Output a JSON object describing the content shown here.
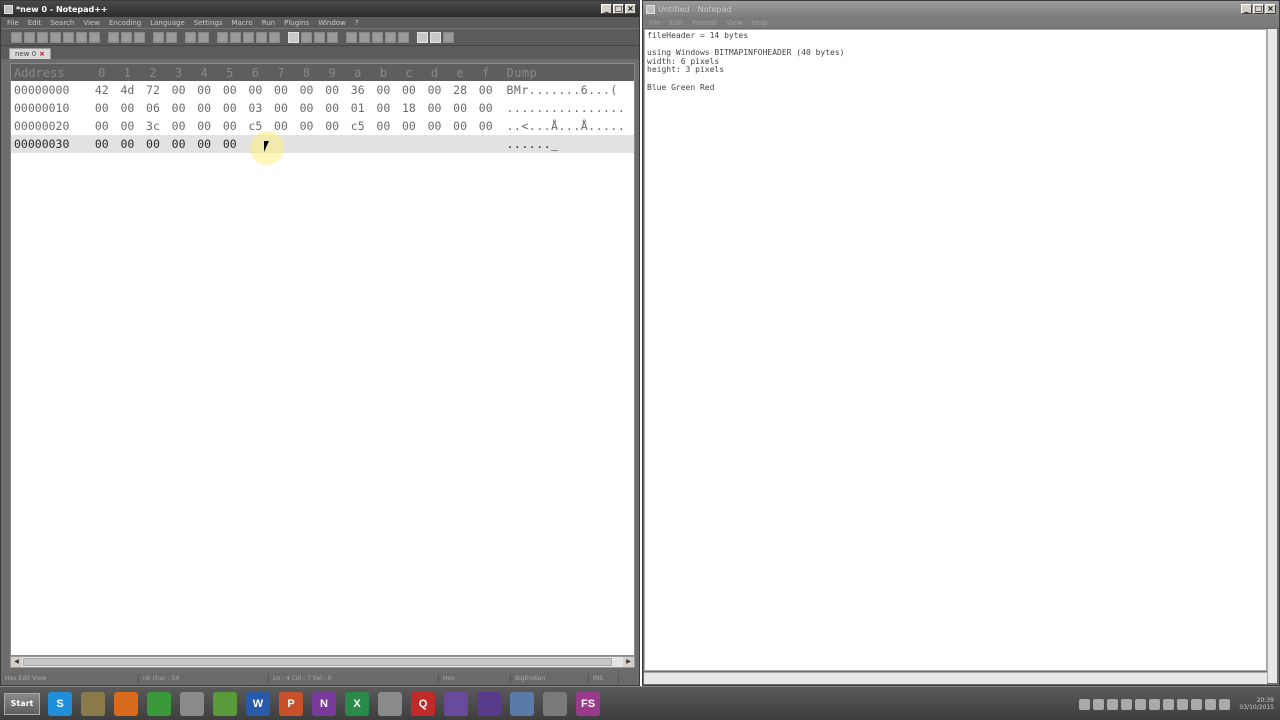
{
  "npp": {
    "title": "*new 0 - Notepad++",
    "menu": [
      "File",
      "Edit",
      "Search",
      "View",
      "Encoding",
      "Language",
      "Settings",
      "Macro",
      "Run",
      "Plugins",
      "Window",
      "?"
    ],
    "tab_label": "new 0",
    "hex_header": {
      "address": "Address",
      "columns": [
        "0",
        "1",
        "2",
        "3",
        "4",
        "5",
        "6",
        "7",
        "8",
        "9",
        "a",
        "b",
        "c",
        "d",
        "e",
        "f"
      ],
      "dump": "Dump"
    },
    "rows": [
      {
        "addr": "00000000",
        "bytes": [
          "42",
          "4d",
          "72",
          "00",
          "00",
          "00",
          "00",
          "00",
          "00",
          "00",
          "36",
          "00",
          "00",
          "00",
          "28",
          "00"
        ],
        "dump": "BMr.......6...("
      },
      {
        "addr": "00000010",
        "bytes": [
          "00",
          "00",
          "06",
          "00",
          "00",
          "00",
          "03",
          "00",
          "00",
          "00",
          "01",
          "00",
          "18",
          "00",
          "00",
          "00"
        ],
        "dump": "................"
      },
      {
        "addr": "00000020",
        "bytes": [
          "00",
          "00",
          "3c",
          "00",
          "00",
          "00",
          "c5",
          "00",
          "00",
          "00",
          "c5",
          "00",
          "00",
          "00",
          "00",
          "00"
        ],
        "dump": "..<...Å...Å....."
      },
      {
        "addr": "00000030",
        "bytes": [
          "00",
          "00",
          "00",
          "00",
          "00",
          "00",
          "",
          "",
          "",
          "",
          "",
          "",
          "",
          "",
          "",
          ""
        ],
        "dump": "......_"
      }
    ],
    "status": [
      "Hex Edit View",
      "nb char : 54",
      "Ln : 4    Col : 7    Sel : 0",
      "Hex",
      "BigEndian",
      "INS"
    ]
  },
  "notepad": {
    "title": "Untitled - Notepad",
    "menu": [
      "File",
      "Edit",
      "Format",
      "View",
      "Help"
    ],
    "text": "fileHeader = 14 bytes\n\nusing Windows BITMAPINFOHEADER (40 bytes)\nwidth: 6 pixels\nheight: 3 pixels\n\nBlue Green Red"
  },
  "taskbar": {
    "start_label": "Start",
    "apps": [
      {
        "name": "skype",
        "glyph": "S",
        "color": "#1e8fd8"
      },
      {
        "name": "folder",
        "glyph": "",
        "color": "#8a7a4a"
      },
      {
        "name": "firefox",
        "glyph": "",
        "color": "#d86a1e"
      },
      {
        "name": "chrome",
        "glyph": "",
        "color": "#3a9a3a"
      },
      {
        "name": "editor",
        "glyph": "",
        "color": "#8a8a8a"
      },
      {
        "name": "notepadpp",
        "glyph": "",
        "color": "#5a9a3a"
      },
      {
        "name": "word",
        "glyph": "W",
        "color": "#2a5aaa"
      },
      {
        "name": "powerpoint",
        "glyph": "P",
        "color": "#c8502a"
      },
      {
        "name": "onenote",
        "glyph": "N",
        "color": "#7a3a9a"
      },
      {
        "name": "excel",
        "glyph": "X",
        "color": "#2a8a4a"
      },
      {
        "name": "tool",
        "glyph": "",
        "color": "#8a8a8a"
      },
      {
        "name": "quicktime",
        "glyph": "Q",
        "color": "#c02a2a"
      },
      {
        "name": "app-purple",
        "glyph": "",
        "color": "#6a4a9a"
      },
      {
        "name": "app-round",
        "glyph": "",
        "color": "#5a3a8a"
      },
      {
        "name": "virtualbox",
        "glyph": "",
        "color": "#5a7aaa"
      },
      {
        "name": "network",
        "glyph": "",
        "color": "#7a7a7a"
      },
      {
        "name": "fs",
        "glyph": "FS",
        "color": "#9a3a8a"
      }
    ],
    "clock_time": "20:39",
    "clock_date": "03/10/2015"
  }
}
